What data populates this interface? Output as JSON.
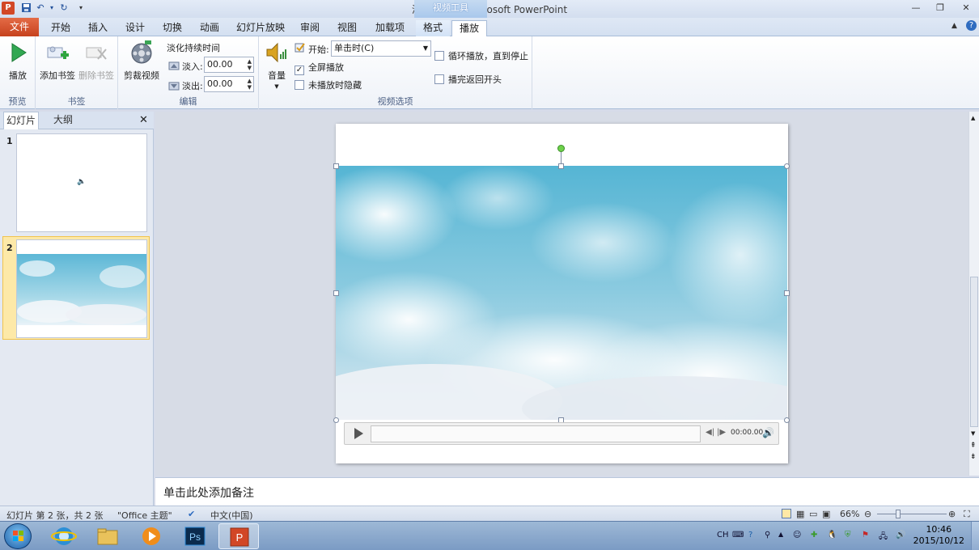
{
  "window": {
    "title": "演示文稿1 - Microsoft PowerPoint",
    "context_tab_group": "视频工具",
    "app_icon_letter": "P"
  },
  "tabs": {
    "file": "文件",
    "items": [
      "开始",
      "插入",
      "设计",
      "切换",
      "动画",
      "幻灯片放映",
      "审阅",
      "视图",
      "加载项",
      "格式",
      "播放"
    ],
    "active": "播放"
  },
  "ribbon": {
    "preview": {
      "play_label": "播放",
      "group_label": "预览"
    },
    "bookmarks": {
      "add_label": "添加书签",
      "remove_label": "删除书签",
      "group_label": "书签"
    },
    "editing": {
      "trim_label": "剪裁视频",
      "fade_title": "淡化持续时间",
      "fade_in_label": "淡入:",
      "fade_in_value": "00.00",
      "fade_out_label": "淡出:",
      "fade_out_value": "00.00",
      "group_label": "编辑"
    },
    "video_options": {
      "volume_label": "音量",
      "start_label": "开始:",
      "start_value": "单击时(C)",
      "fullscreen_label": "全屏播放",
      "fullscreen_checked": true,
      "hide_label": "未播放时隐藏",
      "hide_checked": false,
      "loop_label": "循环播放，直到停止",
      "loop_checked": false,
      "rewind_label": "播完返回开头",
      "rewind_checked": false,
      "group_label": "视频选项"
    }
  },
  "left_panel": {
    "tab_slides": "幻灯片",
    "tab_outline": "大纲",
    "slides": [
      {
        "number": "1"
      },
      {
        "number": "2"
      }
    ]
  },
  "player": {
    "time": "00:00.00"
  },
  "notes": {
    "placeholder": "单击此处添加备注"
  },
  "status": {
    "slide_info": "幻灯片 第 2 张，共 2 张",
    "theme": "\"Office 主题\"",
    "language": "中文(中国)",
    "zoom": "66%"
  },
  "taskbar": {
    "ime": "CH",
    "time": "10:46",
    "date": "2015/10/12"
  },
  "colors": {
    "file_tab": "#d24726",
    "accent": "#1f4e99",
    "selected_thumb": "#f5c451"
  }
}
